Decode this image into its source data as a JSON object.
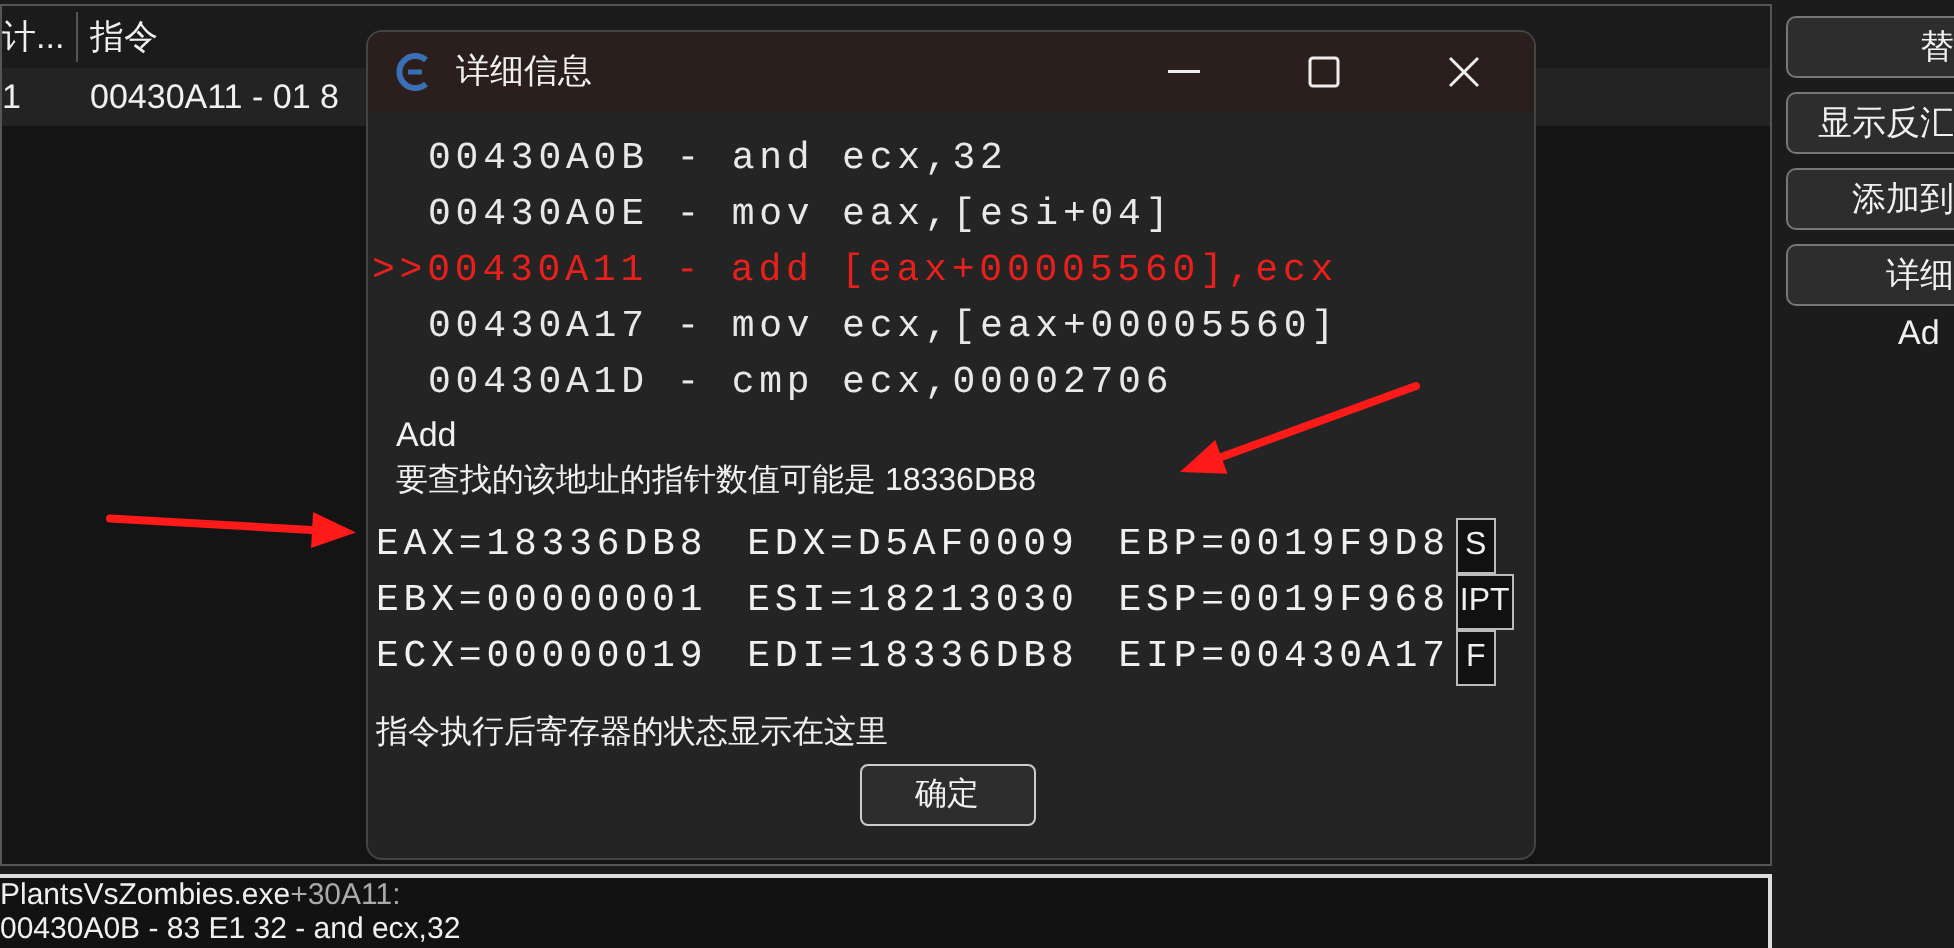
{
  "background_table": {
    "columns": [
      "计...",
      "指令"
    ],
    "rows": [
      {
        "cells": [
          "1",
          "00430A11 - 01 8"
        ],
        "selected": true
      }
    ]
  },
  "side_buttons": [
    "替",
    "显示反汇",
    "添加到",
    "详细"
  ],
  "side_label": "Ad",
  "dialog": {
    "title": "详细信息",
    "code_lines": [
      {
        "text": "00430A0B - and ecx,32",
        "current": false
      },
      {
        "text": "00430A0E - mov eax,[esi+04]",
        "current": false
      },
      {
        "text": ">>00430A11 - add [eax+00005560],ecx",
        "current": true
      },
      {
        "text": "00430A17 - mov ecx,[eax+00005560]",
        "current": false
      },
      {
        "text": "00430A1D - cmp ecx,00002706",
        "current": false
      }
    ],
    "instruction": "Add",
    "pointer_hint": "要查找的该地址的指针数值可能是 18336DB8",
    "registers": [
      [
        "EAX=18336DB8",
        "EDX=D5AF0009",
        "EBP=0019F9D8"
      ],
      [
        "EBX=00000001",
        "ESI=18213030",
        "ESP=0019F968"
      ],
      [
        "ECX=00000019",
        "EDI=18336DB8",
        "EIP=00430A17"
      ]
    ],
    "flags": [
      "S",
      "IPT",
      "F"
    ],
    "note": "指令执行后寄存器的状态显示在这里",
    "ok_button": "确定"
  },
  "bottom_panel": {
    "module": "PlantsVsZombies.exe",
    "offset": "+30A11:",
    "line": "00430A0B - 83 E1 32 - and ecx,32"
  }
}
